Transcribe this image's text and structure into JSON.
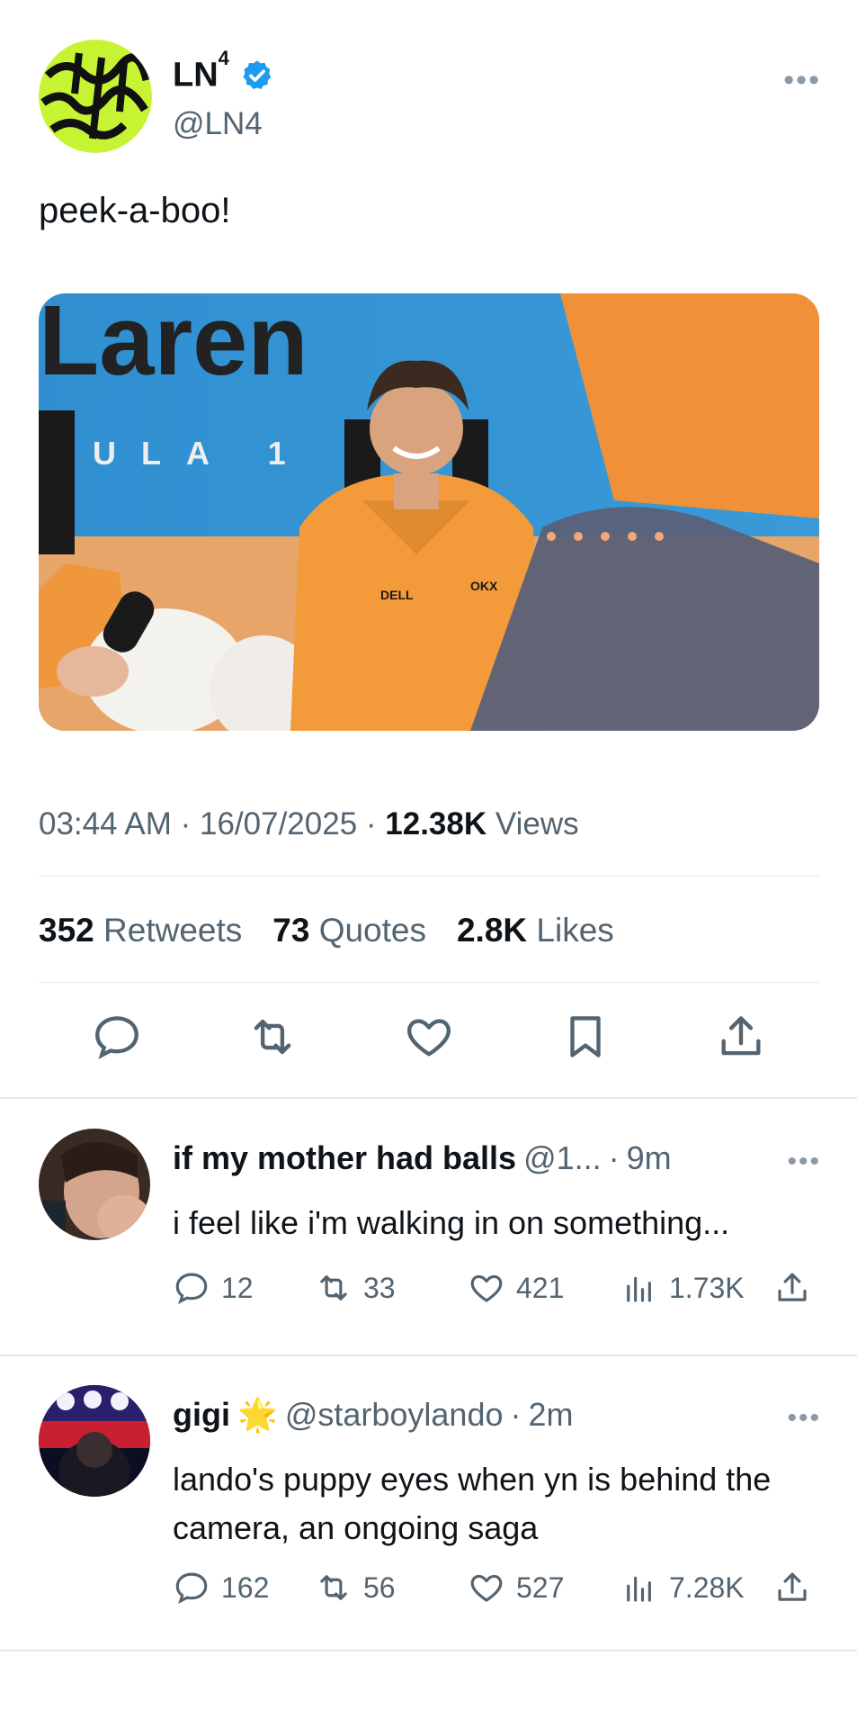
{
  "tweet": {
    "author_name": "LN",
    "author_sup": "4",
    "handle": "@LN4",
    "more": "•••",
    "text": "peek-a-boo!",
    "time": "03:44 AM · 16/07/2025 · ",
    "views_count": "12.38K",
    "views_label": "Views",
    "retweets_count": "352",
    "retweets_label": "Retweets",
    "quotes_count": "73",
    "quotes_label": "Quotes",
    "likes_count": "2.8K",
    "likes_label": "Likes",
    "image_text_top": "Laren",
    "image_text_mid": "ULA 1 T",
    "image_logos": [
      "DELL",
      "OKX"
    ]
  },
  "replies": [
    {
      "name": "if my mother had balls",
      "handle": "@1...",
      "sep": "·",
      "time": "9m",
      "more": "•••",
      "text": "i feel like i'm walking in on something...",
      "replies": "12",
      "retweets": "33",
      "likes": "421",
      "views": "1.73K"
    },
    {
      "name": "gigi",
      "emoji": "🌟",
      "handle": "@starboylando",
      "sep": "·",
      "time": "2m",
      "more": "•••",
      "text": "lando's puppy eyes when yn is behind the camera, an ongoing saga",
      "replies": "162",
      "retweets": "56",
      "likes": "527",
      "views": "7.28K"
    }
  ],
  "colors": {
    "accent": "#1d9bf0",
    "muted": "#536471",
    "text": "#0f1419",
    "avatar_lime": "#c6f433"
  }
}
